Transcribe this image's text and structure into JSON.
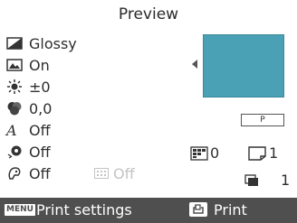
{
  "title": "Preview",
  "settings": [
    {
      "icon": "paper-finish-icon",
      "value": "Glossy"
    },
    {
      "icon": "border-icon",
      "value": "On"
    },
    {
      "icon": "brightness-icon",
      "value": "±0"
    },
    {
      "icon": "color-balance-icon",
      "value": "0,0"
    },
    {
      "icon": "font-text-icon",
      "value": "Off"
    },
    {
      "icon": "red-eye-icon",
      "value": "Off"
    },
    {
      "icon": "face-icon",
      "value": "Off"
    }
  ],
  "grid_setting": {
    "icon": "grid-icon",
    "value": "Off"
  },
  "paper_size_label": "P",
  "counters": {
    "image_count": "0",
    "page_count": "1"
  },
  "copies": {
    "icon": "copies-icon",
    "value": "1"
  },
  "footer": {
    "menu_badge": "MENU",
    "print_settings_label": "Print settings",
    "print_icon": "print-icon",
    "print_label": "Print"
  },
  "colors": {
    "preview_fill": "#4aa0b4",
    "footer_background": "#4f4f4f",
    "disabled_text": "#c4c4c4"
  }
}
